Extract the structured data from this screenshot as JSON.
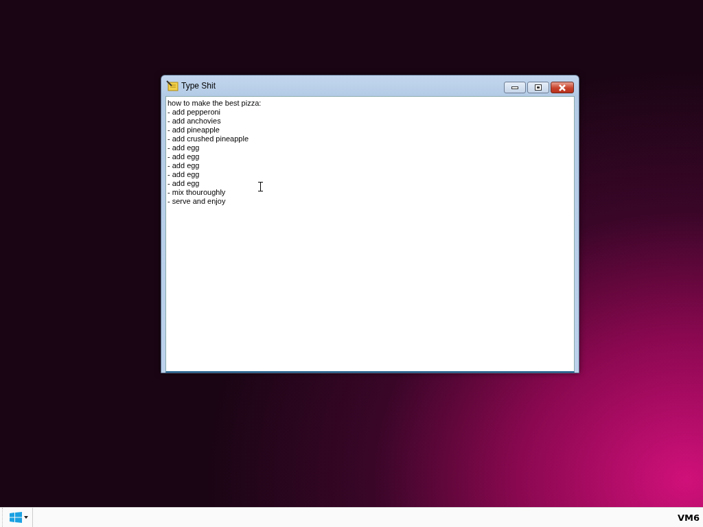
{
  "window": {
    "title": "Type Shit"
  },
  "editor": {
    "lines": [
      "how to make the best pizza:",
      "- add pepperoni",
      "- add anchovies",
      "- add pineapple",
      "- add crushed pineapple",
      "- add egg",
      "- add egg",
      "- add egg",
      "- add egg",
      "- add egg",
      "- mix thouroughly",
      "- serve and enjoy"
    ]
  },
  "taskbar": {
    "label": "VM6"
  }
}
